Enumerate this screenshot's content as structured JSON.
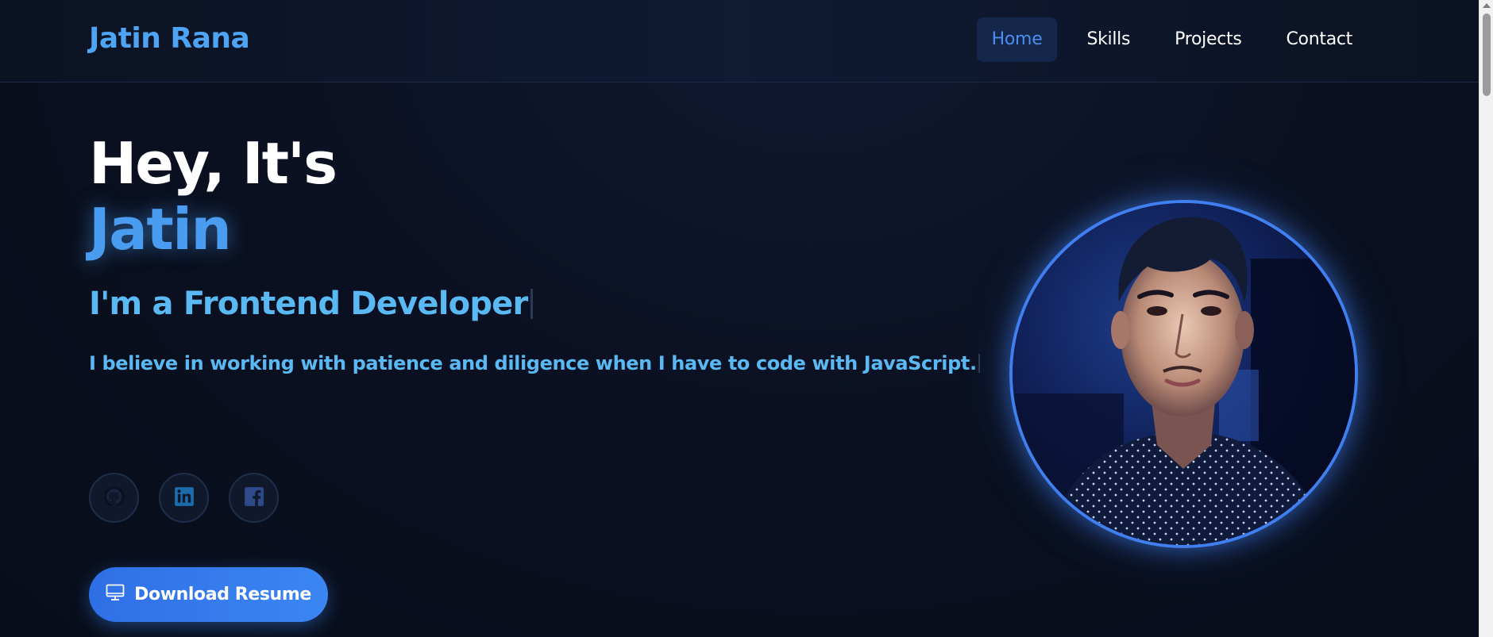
{
  "header": {
    "logo": "Jatin Rana",
    "nav": [
      {
        "label": "Home",
        "active": true
      },
      {
        "label": "Skills",
        "active": false
      },
      {
        "label": "Projects",
        "active": false
      },
      {
        "label": "Contact",
        "active": false
      }
    ]
  },
  "hero": {
    "greeting": "Hey, It's",
    "name": "Jatin",
    "role": "I'm a Frontend Developer",
    "tagline": "I believe in working with patience and diligence when I have to code with JavaScript.",
    "socials": [
      {
        "icon": "github-icon"
      },
      {
        "icon": "linkedin-icon"
      },
      {
        "icon": "facebook-icon"
      }
    ],
    "resume_button": {
      "label": "Download Resume",
      "icon": "monitor-icon"
    }
  },
  "colors": {
    "accent": "#4a9cf0",
    "role_text": "#5ab8f2",
    "background": "#0a0f1e",
    "nav_active_bg": "#14264a",
    "avatar_ring": "#3f7ff0"
  }
}
